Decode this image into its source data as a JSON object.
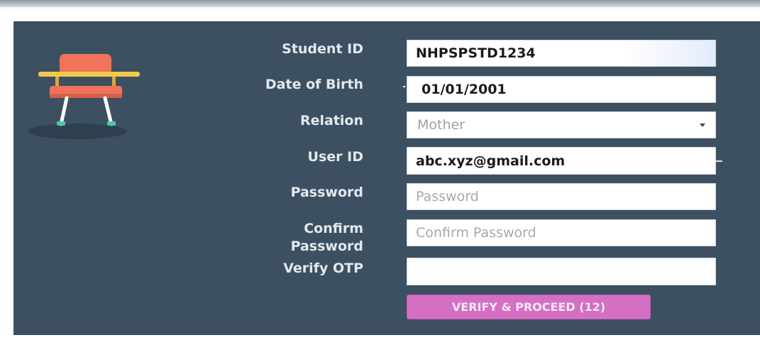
{
  "form": {
    "student_id": {
      "label": "Student ID",
      "value": "NHPSPSTD1234"
    },
    "dob": {
      "label": "Date of Birth",
      "value": "01/01/2001"
    },
    "relation": {
      "label": "Relation",
      "selected": "Mother"
    },
    "user_id": {
      "label": "User ID",
      "value": "abc.xyz@gmail.com"
    },
    "password": {
      "label": "Password",
      "placeholder": "Password"
    },
    "confirm_password": {
      "label_line1": "Confirm",
      "label_line2": "Password",
      "placeholder": "Confirm Password"
    },
    "otp": {
      "label": "Verify OTP",
      "value": ""
    },
    "submit_label": "VERIFY & PROCEED (12)"
  },
  "icons": {
    "illustration": "school-chair-icon",
    "dropdown": "caret-down-icon"
  },
  "colors": {
    "panel": "#3c5061",
    "button": "#d46fc4",
    "chair_seat": "#f0735a",
    "chair_desk": "#f3c94a",
    "chair_legs": "#ffffff",
    "chair_feet": "#4fc7b0"
  }
}
